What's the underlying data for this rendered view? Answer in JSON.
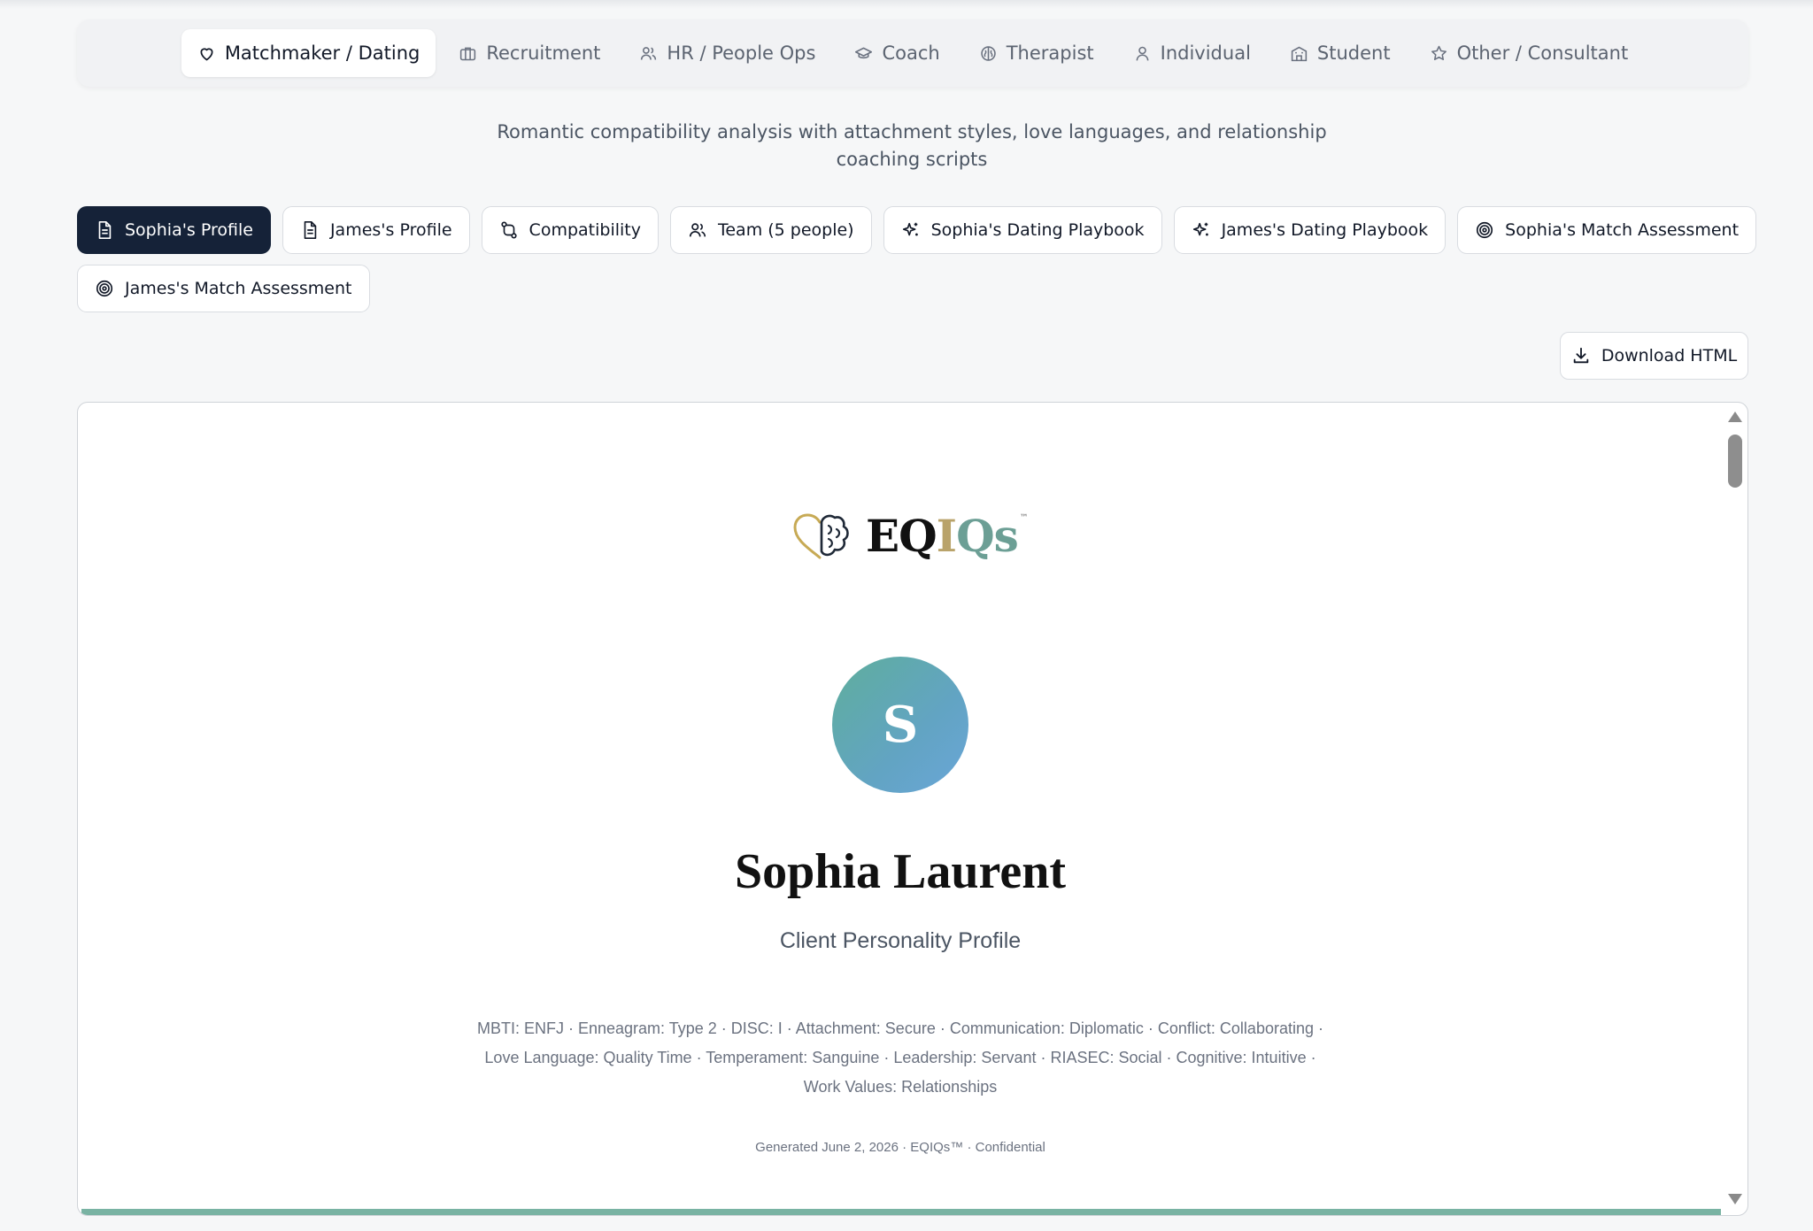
{
  "category_tabs": [
    {
      "label": "Matchmaker / Dating",
      "icon": "heart-icon",
      "active": true
    },
    {
      "label": "Recruitment",
      "icon": "briefcase-icon",
      "active": false
    },
    {
      "label": "HR / People Ops",
      "icon": "users-icon",
      "active": false
    },
    {
      "label": "Coach",
      "icon": "graduation-cap-icon",
      "active": false
    },
    {
      "label": "Therapist",
      "icon": "brain-icon",
      "active": false
    },
    {
      "label": "Individual",
      "icon": "user-icon",
      "active": false
    },
    {
      "label": "Student",
      "icon": "school-icon",
      "active": false
    },
    {
      "label": "Other / Consultant",
      "icon": "star-icon",
      "active": false
    }
  ],
  "subtitle": "Romantic compatibility analysis with attachment styles, love languages, and relationship coaching scripts",
  "report_tabs": [
    {
      "label": "Sophia's Profile",
      "icon": "document-icon",
      "active": true
    },
    {
      "label": "James's Profile",
      "icon": "document-icon",
      "active": false
    },
    {
      "label": "Compatibility",
      "icon": "compare-arrows-icon",
      "active": false
    },
    {
      "label": "Team (5 people)",
      "icon": "users-icon",
      "active": false
    },
    {
      "label": "Sophia's Dating Playbook",
      "icon": "sparkles-icon",
      "active": false
    },
    {
      "label": "James's Dating Playbook",
      "icon": "sparkles-icon",
      "active": false
    },
    {
      "label": "Sophia's Match Assessment",
      "icon": "target-icon",
      "active": false
    },
    {
      "label": "James's Match Assessment",
      "icon": "target-icon",
      "active": false
    }
  ],
  "download_label": "Download HTML",
  "report": {
    "logo": {
      "eq": "EQ",
      "i": "I",
      "qs": "Qs",
      "tm": "™"
    },
    "avatar_initial": "S",
    "client_name": "Sophia Laurent",
    "client_subtitle": "Client Personality Profile",
    "traits": "MBTI: ENFJ · Enneagram: Type 2 · DISC: I · Attachment: Secure · Communication: Diplomatic · Conflict: Collaborating · Love Language: Quality Time · Temperament: Sanguine · Leadership: Servant · RIASEC: Social · Cognitive: Intuitive · Work Values: Relationships",
    "generated": "Generated June 2, 2026 · EQIQs™ · Confidential"
  },
  "colors": {
    "active_tab_bg": "#152238",
    "accent_gold": "#b9a36a",
    "accent_teal": "#6c9f95",
    "avatar_gradient_start": "#5fae9c",
    "avatar_gradient_end": "#6aa6d8"
  }
}
